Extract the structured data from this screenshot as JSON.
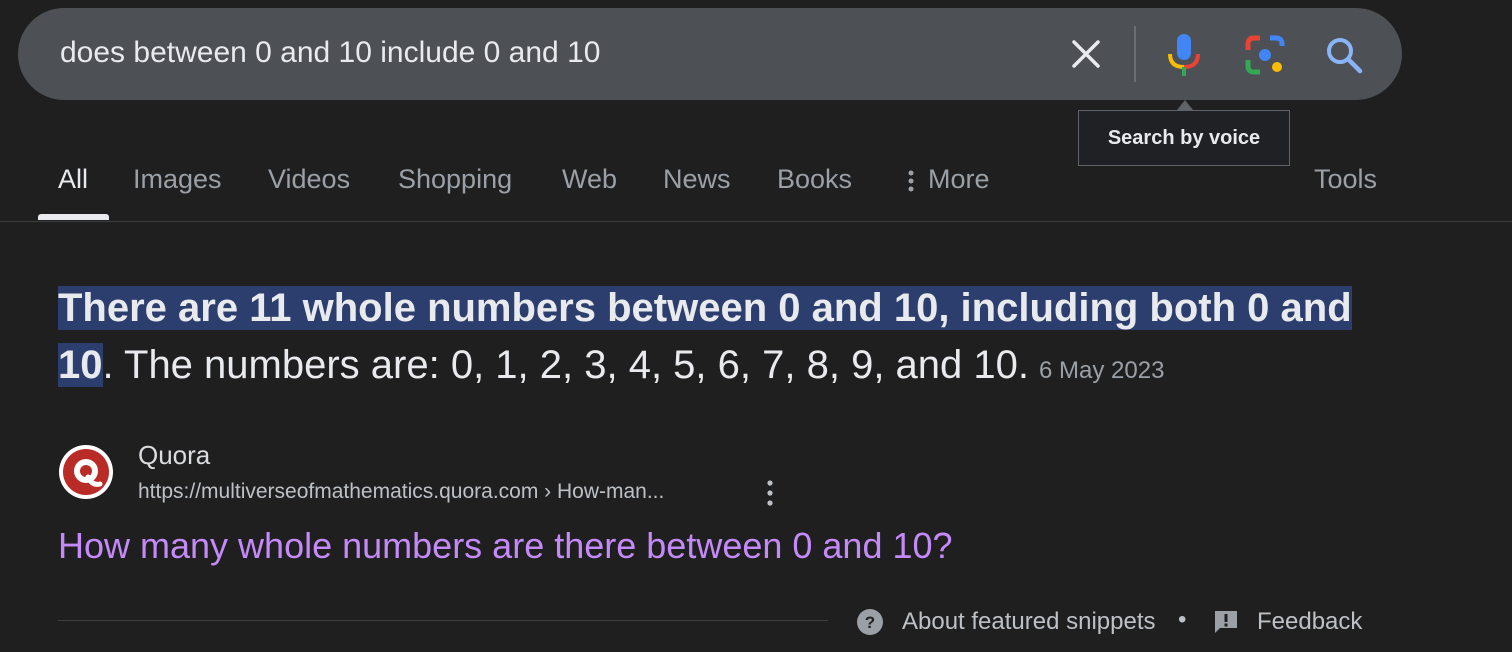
{
  "search": {
    "query": "does between 0 and 10 include 0 and 10",
    "tooltip": "Search by voice"
  },
  "tabs": [
    {
      "label": "All",
      "active": true
    },
    {
      "label": "Images"
    },
    {
      "label": "Videos"
    },
    {
      "label": "Shopping"
    },
    {
      "label": "Web"
    },
    {
      "label": "News"
    },
    {
      "label": "Books"
    },
    {
      "label": "More"
    },
    {
      "label": "Tools"
    }
  ],
  "snippet": {
    "highlight_line1": "There are 11 whole numbers between 0 and 10, including both 0 and",
    "highlight_line2": "10",
    "rest": ". The numbers are: 0, 1, 2, 3, 4, 5, 6, 7, 8, 9, and 10.",
    "date": "6 May 2023"
  },
  "source": {
    "name": "Quora",
    "url": "https://multiverseofmathematics.quora.com › How-man...",
    "title": "How many whole numbers are there between 0 and 10?"
  },
  "footer": {
    "about": "About featured snippets",
    "separator": "•",
    "feedback": "Feedback"
  },
  "colors": {
    "background": "#1f1f1f",
    "searchbar": "#4d5156",
    "highlight": "#2c3e6e",
    "visited_link": "#c58af9",
    "quora_red": "#b92b27"
  },
  "icons": {
    "clear": "close-icon",
    "voice": "microphone-icon",
    "lens": "lens-camera-icon",
    "search": "search-icon",
    "more": "more-vertical-icon",
    "help": "help-circle-icon",
    "feedback": "feedback-icon",
    "favicon": "quora-logo-icon"
  }
}
